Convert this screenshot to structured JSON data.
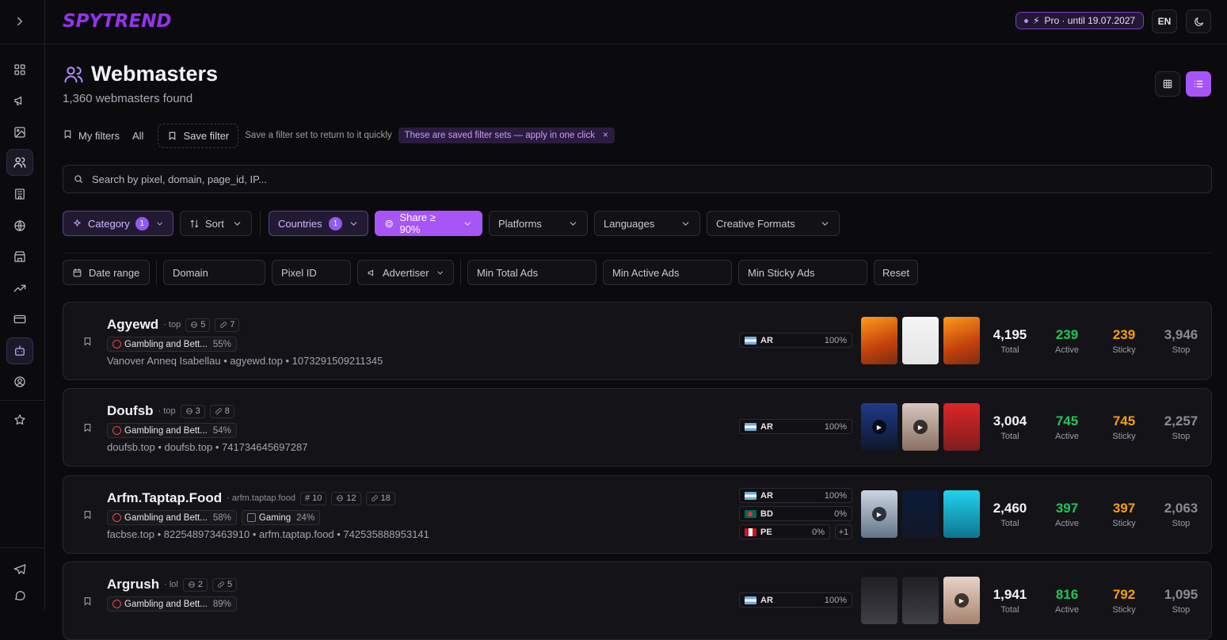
{
  "brand": {
    "logo_text": "SPYTREND",
    "accent": "#a855f7"
  },
  "header": {
    "pro_label": "Pro · until 19.07.2027",
    "lang": "EN"
  },
  "page": {
    "title": "Webmasters",
    "count": "1,360 webmasters found"
  },
  "filters_bar": {
    "my_filters": "My filters",
    "all": "All",
    "save_filter": "Save filter",
    "hint": "Save a filter set to return to it quickly",
    "pill": "These are saved filter sets — apply in one click",
    "pill_close": "×"
  },
  "search": {
    "placeholder": "Search by pixel, domain, page_id, IP..."
  },
  "row1": {
    "category": "Category",
    "category_count": "1",
    "sort": "Sort",
    "countries": "Countries",
    "countries_count": "1",
    "share": "Share ≥ 90%",
    "platforms": "Platforms",
    "languages": "Languages",
    "creative_formats": "Creative Formats"
  },
  "row2": {
    "date_range": "Date range",
    "domain": "Domain",
    "pixel_id": "Pixel ID",
    "advertiser": "Advertiser",
    "min_total": "Min Total Ads",
    "min_active": "Min Active Ads",
    "min_sticky": "Min Sticky Ads",
    "reset": "Reset"
  },
  "labels": {
    "total": "Total",
    "active": "Active",
    "sticky": "Sticky",
    "stop": "Stop"
  },
  "cards": [
    {
      "name": "Agyewd",
      "domain": "· top",
      "c1": "5",
      "c2": "7",
      "cat1": "Gambling and Bett...",
      "cat1_pct": "55%",
      "meta": "Vanover Anneq Isabellau • agyewd.top • 1073291509211345",
      "geo1": "AR",
      "geo1_pct": "100%",
      "total": "4,195",
      "active": "239",
      "sticky": "239",
      "stop": "3,946"
    },
    {
      "name": "Doufsb",
      "domain": "· top",
      "c1": "3",
      "c2": "8",
      "cat1": "Gambling and Bett...",
      "cat1_pct": "54%",
      "meta": "doufsb.top • doufsb.top • 741734645697287",
      "geo1": "AR",
      "geo1_pct": "100%",
      "total": "3,004",
      "active": "745",
      "sticky": "745",
      "stop": "2,257"
    },
    {
      "name": "Arfm.Taptap.Food",
      "domain": "· arfm.taptap.food",
      "c0": "10",
      "c1": "12",
      "c2": "18",
      "cat1": "Gambling and Bett...",
      "cat1_pct": "58%",
      "cat2": "Gaming",
      "cat2_pct": "24%",
      "meta": "facbse.top • 822548973463910 • arfm.taptap.food • 742535888953141",
      "geo1": "AR",
      "geo1_pct": "100%",
      "geo2": "BD",
      "geo2_pct": "0%",
      "geo3": "PE",
      "geo3_pct": "0%",
      "more": "+1",
      "total": "2,460",
      "active": "397",
      "sticky": "397",
      "stop": "2,063"
    },
    {
      "name": "Argrush",
      "domain": "· lol",
      "c1": "2",
      "c2": "5",
      "cat1": "Gambling and Bett...",
      "cat1_pct": "89%",
      "geo1": "AR",
      "geo1_pct": "100%",
      "total": "1,941",
      "active": "816",
      "sticky": "792",
      "stop": "1,095"
    }
  ]
}
